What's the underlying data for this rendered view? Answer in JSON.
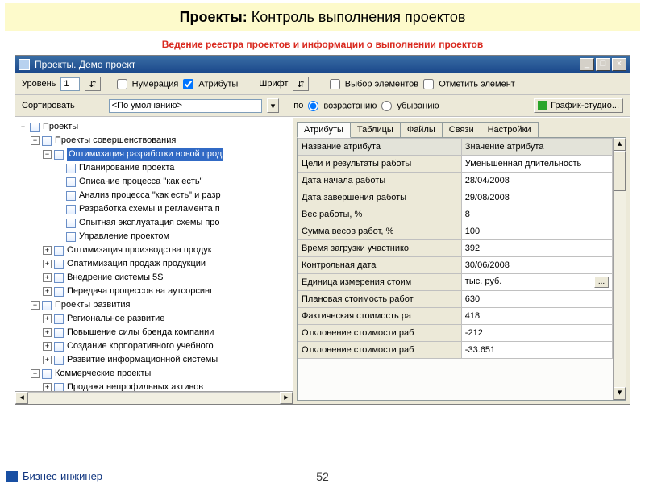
{
  "banner": {
    "bold": "Проекты:",
    "rest": " Контроль выполнения проектов"
  },
  "subtitle": "Ведение реестра проектов и информации о выполнении проектов",
  "window": {
    "title": "Проекты. Демо проект"
  },
  "toolbar1": {
    "level_label": "Уровень",
    "level_value": "1",
    "numbering": "Нумерация",
    "attributes": "Атрибуты",
    "font_label": "Шрифт",
    "select_elems": "Выбор элементов",
    "mark_elem": "Отметить элемент"
  },
  "toolbar2": {
    "sort_label": "Сортировать",
    "sort_value": "<По умолчанию>",
    "by": "по",
    "asc": "возрастанию",
    "desc": "убыванию",
    "studio": "График-студио..."
  },
  "tree": {
    "root": "Проекты",
    "improve": {
      "label": "Проекты совершенствования",
      "opt_newprod": "Оптимизация разработки новой прод",
      "children": [
        "Планирование проекта",
        "Описание процесса \"как есть\"",
        "Анализ процесса \"как есть\" и разр",
        "Разработка схемы и регламента п",
        "Опытная эксплуатация схемы про",
        "Управление проектом"
      ],
      "siblings": [
        "Оптимизация производства продук",
        "Опатимизация продаж продукции",
        "Внедрение системы 5S",
        "Передача процессов на аутсорсинг"
      ]
    },
    "dev": {
      "label": "Проекты развития",
      "children": [
        "Региональное развитие",
        "Повышение силы бренда компании",
        "Создание корпоративного учебного",
        "Развитие информационной системы"
      ]
    },
    "commerce": {
      "label": "Коммерческие проекты",
      "children": [
        "Продажа непрофильных активов"
      ]
    }
  },
  "tabs": [
    "Атрибуты",
    "Таблицы",
    "Файлы",
    "Связи",
    "Настройки"
  ],
  "attr_header": {
    "name": "Название атрибута",
    "value": "Значение атрибута"
  },
  "attributes": [
    {
      "n": "Цели и результаты работы",
      "v": "Уменьшенная длительность"
    },
    {
      "n": "Дата начала работы",
      "v": "28/04/2008"
    },
    {
      "n": "Дата завершения работы",
      "v": "29/08/2008"
    },
    {
      "n": "Вес работы, %",
      "v": "8"
    },
    {
      "n": "Сумма весов работ, %",
      "v": "100"
    },
    {
      "n": "Время загрузки участнико",
      "v": "392"
    },
    {
      "n": "Контрольная дата",
      "v": "30/06/2008"
    },
    {
      "n": "Единица измерения стоим",
      "v": "тыс. руб."
    },
    {
      "n": "Плановая стоимость работ",
      "v": "630"
    },
    {
      "n": "Фактическая стоимость ра",
      "v": "418"
    },
    {
      "n": "Отклонение стоимости раб",
      "v": "-212"
    },
    {
      "n": "Отклонение стоимости раб",
      "v": "-33.651"
    }
  ],
  "footer": {
    "brand": "Бизнес-инжинер",
    "page": "52"
  }
}
